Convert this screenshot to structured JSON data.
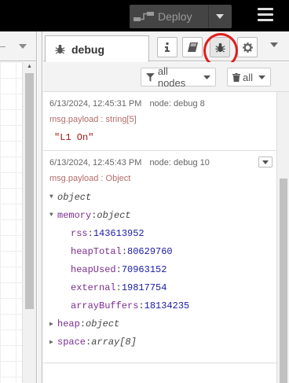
{
  "header": {
    "deploy_label": "Deploy",
    "icons": [
      "deploy-icon",
      "caret-down-icon",
      "hamburger-menu-icon"
    ]
  },
  "sidebar": {
    "tab_label": "debug",
    "tab_buttons": [
      "info-icon",
      "book-icon",
      "bug-icon",
      "gear-icon"
    ],
    "selected_tab_button": "bug-icon",
    "highlight_color": "#e31c1c",
    "filter_nodes_label": "all nodes",
    "clear_label": "all"
  },
  "messages": [
    {
      "timestamp": "6/13/2024, 12:45:31 PM",
      "node": "node: debug 8",
      "payload_type": "msg.payload : string[5]",
      "value": "\"L1 On\""
    },
    {
      "timestamp": "6/13/2024, 12:45:43 PM",
      "node": "node: debug 10",
      "payload_type": "msg.payload : Object",
      "tree": {
        "root_label": "object",
        "memory_key": "memory",
        "memory_type": "object",
        "fields": [
          {
            "key": "rss",
            "value": "143613952"
          },
          {
            "key": "heapTotal",
            "value": "80629760"
          },
          {
            "key": "heapUsed",
            "value": "70963152"
          },
          {
            "key": "external",
            "value": "19817754"
          },
          {
            "key": "arrayBuffers",
            "value": "18134235"
          }
        ],
        "heap_key": "heap",
        "heap_type": "object",
        "space_key": "space",
        "space_type": "array[8]"
      }
    }
  ]
}
